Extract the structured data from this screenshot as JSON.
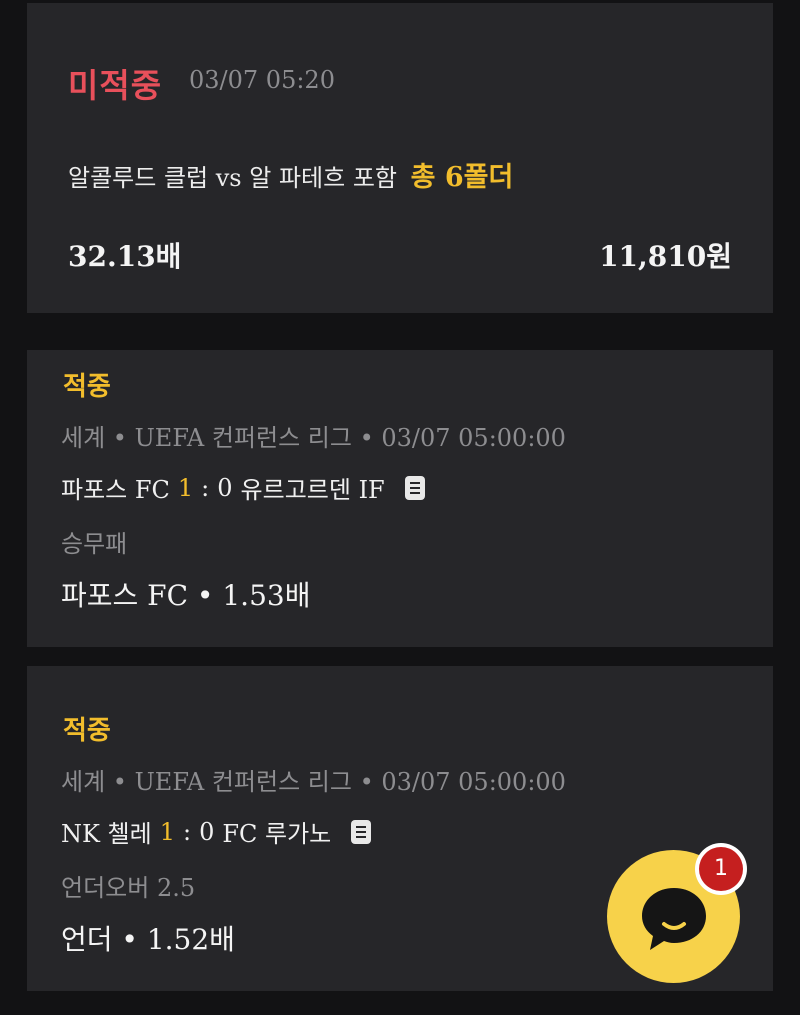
{
  "summary": {
    "status": "미적중",
    "datetime": "03/07 05:20",
    "match": "알콜루드 클럽 vs 알 파테흐 포함",
    "folder_count": "총 6폴더",
    "odds": "32.13배",
    "amount": "11,810원"
  },
  "bets": [
    {
      "status": "적중",
      "league": "세계 • UEFA 컨퍼런스 리그 • 03/07 05:00:00",
      "home_team": "파포스 FC",
      "home_score": "1",
      "separator": ":",
      "away_score": "0",
      "away_team": "유르고르덴 IF",
      "market": "승무패",
      "pick": "파포스 FC • 1.53배"
    },
    {
      "status": "적중",
      "league": "세계 • UEFA 컨퍼런스 리그 • 03/07 05:00:00",
      "home_team": "NK 첼레",
      "home_score": "1",
      "separator": ":",
      "away_score": "0",
      "away_team": "FC 루가노",
      "market": "언더오버 2.5",
      "pick": "언더 • 1.52배"
    }
  ],
  "chat": {
    "badge_count": "1",
    "icon": "chat-bubble-icon"
  },
  "colors": {
    "lost": "#e8505b",
    "hit": "#f2bd2c",
    "chat_button": "#f7d24a",
    "badge": "#c51f1f"
  }
}
